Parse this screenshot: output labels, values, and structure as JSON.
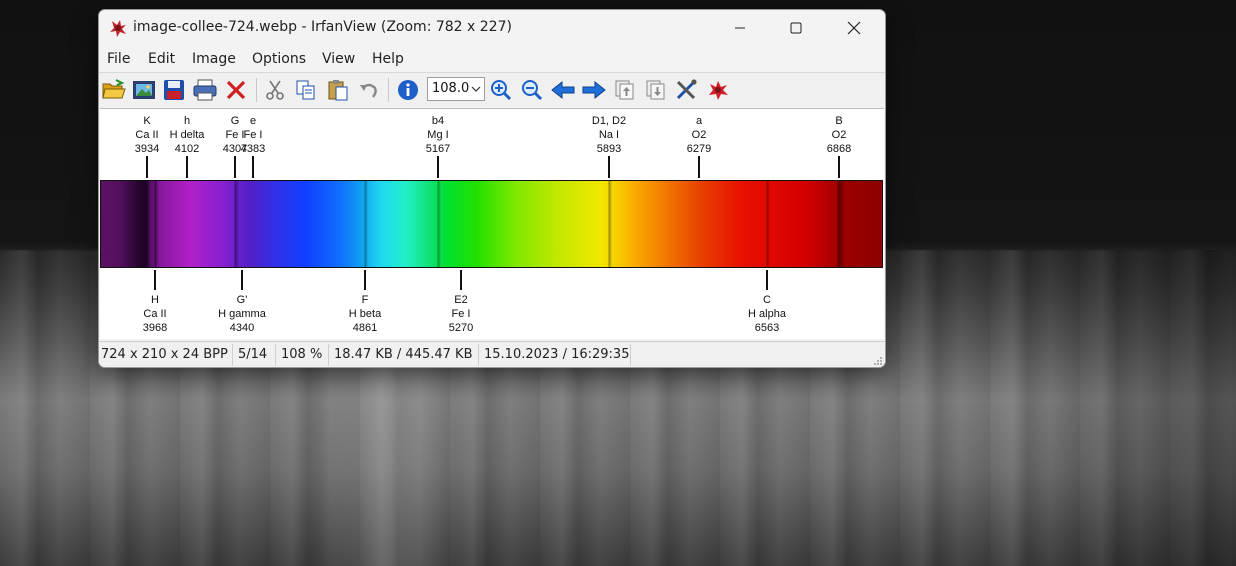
{
  "window": {
    "title": "image-collee-724.webp - IrfanView (Zoom: 782 x 227)"
  },
  "menu": [
    "File",
    "Edit",
    "Image",
    "Options",
    "View",
    "Help"
  ],
  "toolbar": {
    "zoom_value": "108.0",
    "icons": [
      "open-folder-icon",
      "slideshow-icon",
      "save-icon",
      "print-icon",
      "delete-icon",
      "cut-icon",
      "copy-icon",
      "paste-icon",
      "undo-icon",
      "info-icon",
      "zoom-in-icon",
      "zoom-out-icon",
      "previous-icon",
      "next-icon",
      "page-up-icon",
      "page-down-icon",
      "settings-icon",
      "irfanview-icon"
    ]
  },
  "spectrum": {
    "top_lines": [
      {
        "letter": "K",
        "element": "Ca II",
        "wavelength": "3934"
      },
      {
        "letter": "h",
        "element": "H delta",
        "wavelength": "4102"
      },
      {
        "letter": "G",
        "element": "Fe I",
        "wavelength": "4307"
      },
      {
        "letter": "e",
        "element": "Fe I",
        "wavelength": "4383"
      },
      {
        "letter": "b4",
        "element": "Mg I",
        "wavelength": "5167"
      },
      {
        "letter": "D1, D2",
        "element": "Na I",
        "wavelength": "5893"
      },
      {
        "letter": "a",
        "element": "O2",
        "wavelength": "6279"
      },
      {
        "letter": "B",
        "element": "O2",
        "wavelength": "6868"
      }
    ],
    "bottom_lines": [
      {
        "letter": "H",
        "element": "Ca II",
        "wavelength": "3968"
      },
      {
        "letter": "G'",
        "element": "H gamma",
        "wavelength": "4340"
      },
      {
        "letter": "F",
        "element": "H beta",
        "wavelength": "4861"
      },
      {
        "letter": "E2",
        "element": "Fe I",
        "wavelength": "5270"
      },
      {
        "letter": "C",
        "element": "H alpha",
        "wavelength": "6563"
      }
    ]
  },
  "status": {
    "dimensions": "724 x 210 x 24 BPP",
    "index": "5/14",
    "zoom": "108 %",
    "size": "18.47 KB / 445.47 KB",
    "datetime": "15.10.2023 / 16:29:35"
  },
  "colors": {
    "accent_blue": "#1e6fd9",
    "delete_red": "#d21f1f"
  }
}
